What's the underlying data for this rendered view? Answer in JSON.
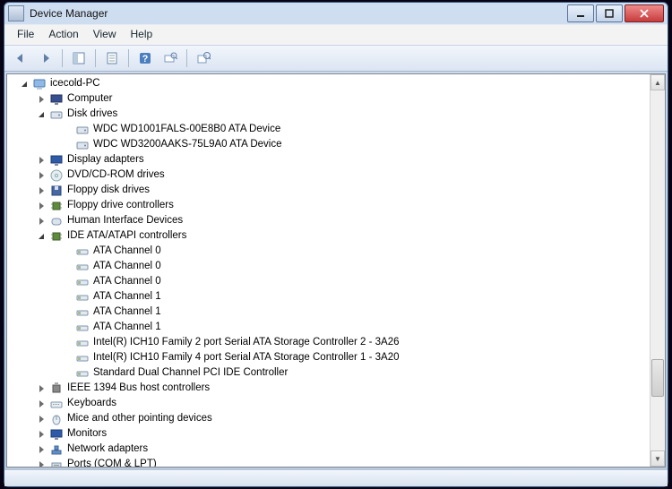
{
  "window": {
    "title": "Device Manager"
  },
  "menu": {
    "file": "File",
    "action": "Action",
    "view": "View",
    "help": "Help"
  },
  "tree": {
    "root": {
      "label": "icecold-PC"
    },
    "computer": {
      "label": "Computer"
    },
    "disk_drives": {
      "label": "Disk drives",
      "children": [
        "WDC WD1001FALS-00E8B0 ATA Device",
        "WDC WD3200AAKS-75L9A0 ATA Device"
      ]
    },
    "display_adapters": {
      "label": "Display adapters"
    },
    "dvd": {
      "label": "DVD/CD-ROM drives"
    },
    "floppy_disk": {
      "label": "Floppy disk drives"
    },
    "floppy_ctrl": {
      "label": "Floppy drive controllers"
    },
    "hid": {
      "label": "Human Interface Devices"
    },
    "ide": {
      "label": "IDE ATA/ATAPI controllers",
      "children": [
        "ATA Channel 0",
        "ATA Channel 0",
        "ATA Channel 0",
        "ATA Channel 1",
        "ATA Channel 1",
        "ATA Channel 1",
        "Intel(R) ICH10 Family 2 port Serial ATA Storage Controller 2 - 3A26",
        "Intel(R) ICH10 Family 4 port Serial ATA Storage Controller 1 - 3A20",
        "Standard Dual Channel PCI IDE Controller"
      ]
    },
    "ieee1394": {
      "label": "IEEE 1394 Bus host controllers"
    },
    "keyboards": {
      "label": "Keyboards"
    },
    "mice": {
      "label": "Mice and other pointing devices"
    },
    "monitors": {
      "label": "Monitors"
    },
    "network": {
      "label": "Network adapters"
    },
    "ports": {
      "label": "Ports (COM & LPT)"
    }
  }
}
